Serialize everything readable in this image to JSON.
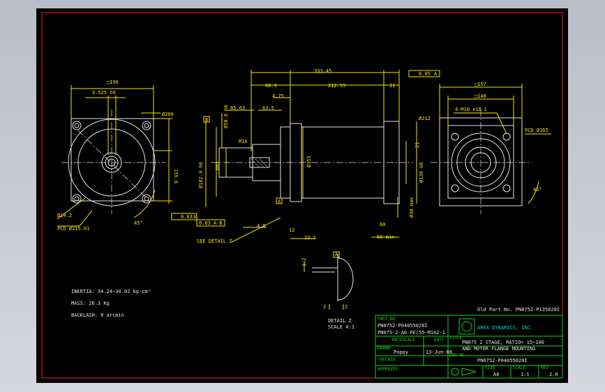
{
  "drawing": {
    "front_view": {
      "square": "□190",
      "keyway": "9.525 h9",
      "keyway_tol": "+0 / -0.036",
      "dia_outer": "Ø260",
      "center_dist": "155.6",
      "hole": "Ø14.2",
      "pcd": "PCD Ø215.01",
      "angle": "45°"
    },
    "side_view": {
      "overall": "333.45",
      "len_1": "88.9",
      "len_2": "212.55",
      "len_3": "21",
      "len_4": "4.75",
      "len_5": "63.5",
      "len_6": "85.63",
      "dia_shaft": "Ø50.8 h6",
      "dia_shaft_tol": "+0 / -0.016",
      "key": "M16",
      "dia_pilot": "Ø63",
      "dia_flange": "Ø182.4 h6",
      "dia_flange_tol": "+0 / -0.029",
      "dia_body": "Ø155",
      "dia_motor": "Ø212",
      "dia_motor_pilot": "Ø130 G6",
      "dia_motor_pilot_tol": "+0.039 / +0.014",
      "dia_max": "Ø38 max",
      "dim_a": "4.8",
      "dim_b": "12",
      "dim_c": "22.2",
      "dim_d": "60 max",
      "dim_e": "60",
      "dim_f": "21",
      "datum_a": "A",
      "datum_b": "B",
      "gdt_1": "0.03",
      "gdt_1_ref": "A",
      "gdt_2": "0.03",
      "gdt_2_ref": "A-B",
      "gdt_3": "0.05",
      "gdt_3_ref": "A",
      "see_detail": "SEE DETAIL Z"
    },
    "rear_view": {
      "square_1": "□157",
      "square_2": "□148",
      "holes": "4-M10 x18 L",
      "pcd": "PCD Ø165",
      "angle": "45°"
    },
    "detail": {
      "title": "DETAIL Z",
      "scale": "SCALE 4:1",
      "dim_a": "1.2",
      "dim_b": "2",
      "dim_c": "2",
      "datum": "A"
    },
    "notes": {
      "inertia": "INERTIA: 34.24~34.02 kg-cm²",
      "mass": "MASS: 26.3 Kg",
      "backlash": "BACKLASH: 8 arcmin"
    },
    "old_part": "Old Part No. PN0752-P135020I"
  },
  "title_block": {
    "part_no_label": "PART NO",
    "part_no": "PN0752-P04055020I",
    "part_no_2": "PN075-2-A0-PE(55-M142-1",
    "drawn_label": "DRAWN",
    "drawn_by": "Poppy",
    "date_label": "DATE",
    "date": "13-Jun-08",
    "checked_label": "CHECKED",
    "approved_label": "APPROVED",
    "material_label": "MATERIALS",
    "company": "APEX DYNAMICS, INC.",
    "title_label": "TITLE",
    "title_line1": "PN075 2 STAGE, RATIO= 15~100",
    "title_line2": "AND MOTOR FLANGE MOUNTING",
    "dwg_label": "DWG NO",
    "dwg_no": "PN0752-P04055020I",
    "size_label": "SIZE",
    "size": "A0",
    "scale_label": "SCALE",
    "scale": "1:1",
    "rev_label": "REV",
    "rev": "2.0"
  },
  "colors": {
    "line": "#f5e600",
    "text": "#e6e6e6",
    "border": "#ff1a1a",
    "title_block": "#14d514",
    "background": "#000000"
  }
}
